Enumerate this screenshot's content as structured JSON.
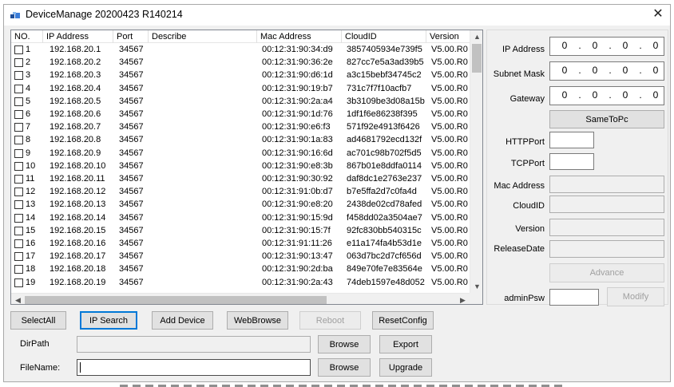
{
  "window": {
    "title": "DeviceManage 20200423 R140214",
    "close_glyph": "✕"
  },
  "table": {
    "headers": [
      "NO.",
      "IP Address",
      "Port",
      "Describe",
      "Mac Address",
      "CloudID",
      "Version"
    ],
    "rows": [
      {
        "no": "1",
        "ip": "192.168.20.1",
        "port": "34567",
        "describe": "",
        "mac": "00:12:31:90:34:d9",
        "cloud": "3857405934e739f5",
        "version": "V5.00.R0"
      },
      {
        "no": "2",
        "ip": "192.168.20.2",
        "port": "34567",
        "describe": "",
        "mac": "00:12:31:90:36:2e",
        "cloud": "827cc7e5a3ad39b5",
        "version": "V5.00.R0"
      },
      {
        "no": "3",
        "ip": "192.168.20.3",
        "port": "34567",
        "describe": "",
        "mac": "00:12:31:90:d6:1d",
        "cloud": "a3c15bebf34745c2",
        "version": "V5.00.R0"
      },
      {
        "no": "4",
        "ip": "192.168.20.4",
        "port": "34567",
        "describe": "",
        "mac": "00:12:31:90:19:b7",
        "cloud": "731c7f7f10acfb7",
        "version": "V5.00.R0"
      },
      {
        "no": "5",
        "ip": "192.168.20.5",
        "port": "34567",
        "describe": "",
        "mac": "00:12:31:90:2a:a4",
        "cloud": "3b3109be3d08a15b",
        "version": "V5.00.R0"
      },
      {
        "no": "6",
        "ip": "192.168.20.6",
        "port": "34567",
        "describe": "",
        "mac": "00:12:31:90:1d:76",
        "cloud": "1df1f6e86238f395",
        "version": "V5.00.R0"
      },
      {
        "no": "7",
        "ip": "192.168.20.7",
        "port": "34567",
        "describe": "",
        "mac": "00:12:31:90:e6:f3",
        "cloud": "571f92e4913f6426",
        "version": "V5.00.R0"
      },
      {
        "no": "8",
        "ip": "192.168.20.8",
        "port": "34567",
        "describe": "",
        "mac": "00:12:31:90:1a:83",
        "cloud": "ad4681792ecd132f",
        "version": "V5.00.R0"
      },
      {
        "no": "9",
        "ip": "192.168.20.9",
        "port": "34567",
        "describe": "",
        "mac": "00:12:31:90:16:6d",
        "cloud": "ac701c98b702f5d5",
        "version": "V5.00.R0"
      },
      {
        "no": "10",
        "ip": "192.168.20.10",
        "port": "34567",
        "describe": "",
        "mac": "00:12:31:90:e8:3b",
        "cloud": "867b01e8ddfa0114",
        "version": "V5.00.R0"
      },
      {
        "no": "11",
        "ip": "192.168.20.11",
        "port": "34567",
        "describe": "",
        "mac": "00:12:31:90:30:92",
        "cloud": "daf8dc1e2763e237",
        "version": "V5.00.R0"
      },
      {
        "no": "12",
        "ip": "192.168.20.12",
        "port": "34567",
        "describe": "",
        "mac": "00:12:31:91:0b:d7",
        "cloud": "b7e5ffa2d7c0fa4d",
        "version": "V5.00.R0"
      },
      {
        "no": "13",
        "ip": "192.168.20.13",
        "port": "34567",
        "describe": "",
        "mac": "00:12:31:90:e8:20",
        "cloud": "2438de02cd78afed",
        "version": "V5.00.R0"
      },
      {
        "no": "14",
        "ip": "192.168.20.14",
        "port": "34567",
        "describe": "",
        "mac": "00:12:31:90:15:9d",
        "cloud": "f458dd02a3504ae7",
        "version": "V5.00.R0"
      },
      {
        "no": "15",
        "ip": "192.168.20.15",
        "port": "34567",
        "describe": "",
        "mac": "00:12:31:90:15:7f",
        "cloud": "92fc830bb540315c",
        "version": "V5.00.R0"
      },
      {
        "no": "16",
        "ip": "192.168.20.16",
        "port": "34567",
        "describe": "",
        "mac": "00:12:31:91:11:26",
        "cloud": "e11a174fa4b53d1e",
        "version": "V5.00.R0"
      },
      {
        "no": "17",
        "ip": "192.168.20.17",
        "port": "34567",
        "describe": "",
        "mac": "00:12:31:90:13:47",
        "cloud": "063d7bc2d7cf656d",
        "version": "V5.00.R0"
      },
      {
        "no": "18",
        "ip": "192.168.20.18",
        "port": "34567",
        "describe": "",
        "mac": "00:12:31:90:2d:ba",
        "cloud": "849e70fe7e83564e",
        "version": "V5.00.R0"
      },
      {
        "no": "19",
        "ip": "192.168.20.19",
        "port": "34567",
        "describe": "",
        "mac": "00:12:31:90:2a:43",
        "cloud": "74deb1597e48d052",
        "version": "V5.00.R0"
      }
    ]
  },
  "toolbar": {
    "select_all": "SelectAll",
    "ip_search": "IP Search",
    "add_device": "Add Device",
    "web_browse": "WebBrowse",
    "reboot": "Reboot",
    "reset_config": "ResetConfig"
  },
  "dirpath": {
    "label": "DirPath",
    "value": "",
    "browse": "Browse",
    "action": "Export"
  },
  "filename": {
    "label": "FileName:",
    "value": "",
    "browse": "Browse",
    "action": "Upgrade"
  },
  "panel": {
    "ip_address_label": "IP Address",
    "ip_address": [
      "0",
      "0",
      "0",
      "0"
    ],
    "subnet_mask_label": "Subnet Mask",
    "subnet_mask": [
      "0",
      "0",
      "0",
      "0"
    ],
    "gateway_label": "Gateway",
    "gateway": [
      "0",
      "0",
      "0",
      "0"
    ],
    "same_to_pc": "SameToPc",
    "http_port_label": "HTTPPort",
    "http_port": "",
    "tcp_port_label": "TCPPort",
    "tcp_port": "",
    "mac_label": "Mac Address",
    "mac": "",
    "cloud_label": "CloudID",
    "cloud": "",
    "version_label": "Version",
    "version": "",
    "release_label": "ReleaseDate",
    "release": "",
    "advance": "Advance",
    "admin_psw_label": "adminPsw",
    "admin_psw": "",
    "modify": "Modify"
  },
  "colors": {
    "window_bg": "#f0f0f0",
    "button_bg": "#e1e1e1",
    "focus_border": "#0078d7",
    "disabled_text": "#a0a0a0"
  },
  "icons": [
    "app-icon",
    "close-icon",
    "scroll-up-icon",
    "scroll-down-icon",
    "scroll-left-icon",
    "scroll-right-icon",
    "checkbox-icon"
  ]
}
